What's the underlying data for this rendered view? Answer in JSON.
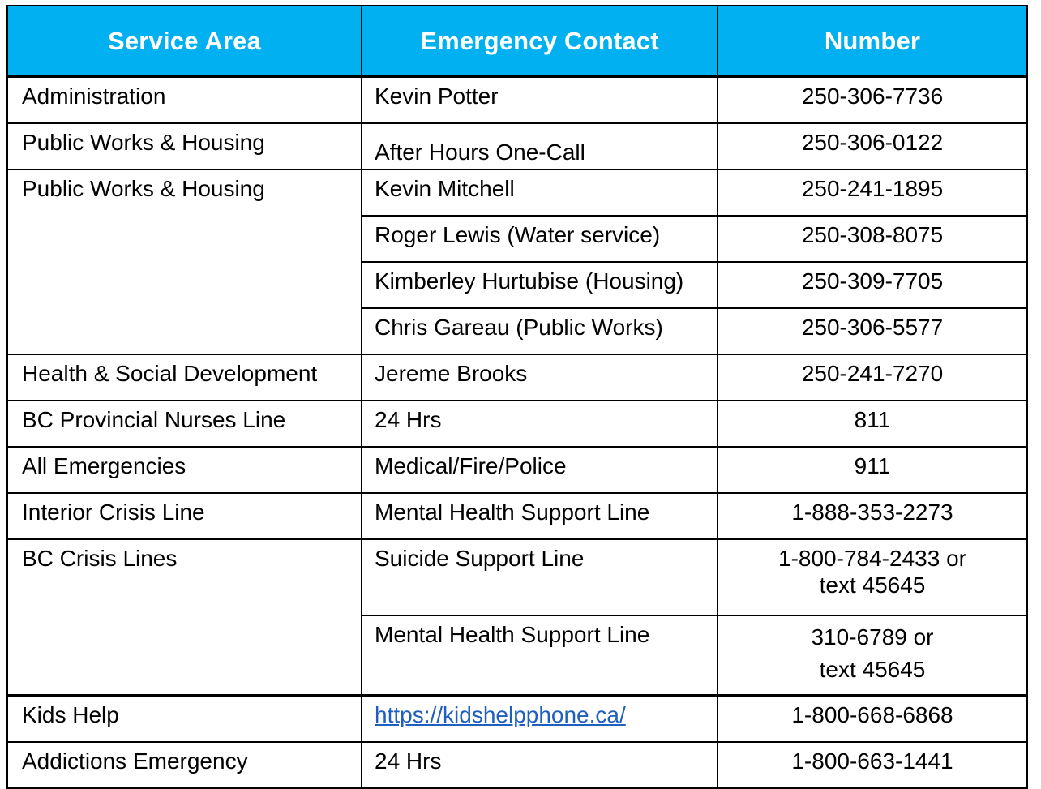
{
  "header": {
    "col1": "Service Area",
    "col2": "Emergency Contact",
    "col3": "Number",
    "color": "#00B0F0"
  },
  "rows": [
    {
      "area": "Administration",
      "contact": "Kevin Potter",
      "number": "250-306-7736"
    },
    {
      "area": "Public Works & Housing",
      "contact": "After Hours One-Call",
      "number": "250-306-0122"
    },
    {
      "area": "Public Works & Housing",
      "contact": "Kevin Mitchell",
      "number": "250-241-1895"
    },
    {
      "area": "",
      "contact": "Roger Lewis (Water service)",
      "number": "250-308-8075"
    },
    {
      "area": "",
      "contact": "Kimberley Hurtubise (Housing)",
      "number": "250-309-7705"
    },
    {
      "area": "",
      "contact": "Chris Gareau (Public Works)",
      "number": "250-306-5577"
    },
    {
      "area": "Health & Social Development",
      "contact": "Jereme Brooks",
      "number": "250-241-7270"
    },
    {
      "area": "BC Provincial Nurses Line",
      "contact": "24 Hrs",
      "number": "811"
    },
    {
      "area": "All Emergencies",
      "contact": "Medical/Fire/Police",
      "number": "911"
    },
    {
      "area": "Interior Crisis Line",
      "contact": "Mental Health Support Line",
      "number": "1-888-353-2273"
    },
    {
      "area": "BC Crisis Lines",
      "contact": "Suicide Support Line",
      "number_line1": "1-800-784-2433 or",
      "number_line2": "text 45645"
    },
    {
      "area": "",
      "contact": "Mental Health Support Line",
      "number_line1": "310-6789 or",
      "number_line2": "text 45645"
    },
    {
      "area": "Kids Help",
      "contact": "https://kidshelpphone.ca/",
      "number": "1-800-668-6868"
    },
    {
      "area": "Addictions Emergency",
      "contact": "24 Hrs",
      "number": "1-800-663-1441"
    }
  ]
}
